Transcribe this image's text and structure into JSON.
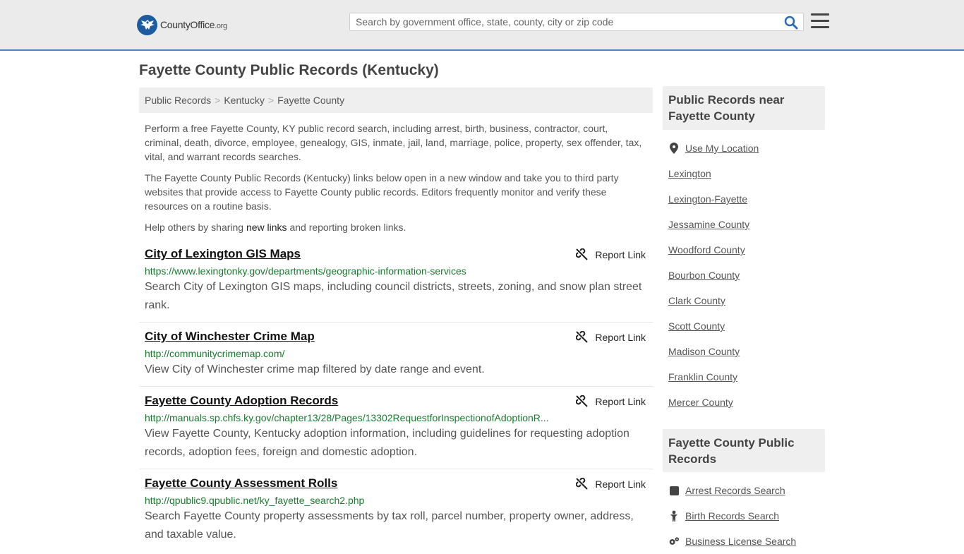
{
  "header": {
    "logo_brand": "CountyOffice",
    "logo_tld": ".org",
    "search_placeholder": "Search by government office, state, county, city or zip code"
  },
  "page": {
    "title": "Fayette County Public Records (Kentucky)"
  },
  "breadcrumb": [
    "Public Records",
    "Kentucky",
    "Fayette County"
  ],
  "intro": {
    "p1": "Perform a free Fayette County, KY public record search, including arrest, birth, business, contractor, court, criminal, death, divorce, employee, genealogy, GIS, inmate, jail, land, marriage, police, property, sex offender, tax, vital, and warrant records searches.",
    "p2": "The Fayette County Public Records (Kentucky) links below open in a new window and take you to third party websites that provide access to Fayette County public records. Editors frequently monitor and verify these resources on a routine basis.",
    "p3_before": "Help others by sharing ",
    "p3_link": "new links",
    "p3_after": " and reporting broken links."
  },
  "report_label": "Report Link",
  "records": [
    {
      "title": "City of Lexington GIS Maps",
      "url": "https://www.lexingtonky.gov/departments/geographic-information-services",
      "desc": "Search City of Lexington GIS maps, including council districts, streets, zoning, and snow plan street rank."
    },
    {
      "title": "City of Winchester Crime Map",
      "url": "http://communitycrimemap.com/",
      "desc": "View City of Winchester crime map filtered by date range and event."
    },
    {
      "title": "Fayette County Adoption Records",
      "url": "http://manuals.sp.chfs.ky.gov/chapter13/28/Pages/13302RequestforInspectionofAdoptionR...",
      "desc": "View Fayette County, Kentucky adoption information, including guidelines for requesting adoption records, adoption fees, foreign and domestic adoption."
    },
    {
      "title": "Fayette County Assessment Rolls",
      "url": "http://qpublic9.qpublic.net/ky_fayette_search2.php",
      "desc": "Search Fayette County property assessments by tax roll, parcel number, property owner, address, and taxable value."
    }
  ],
  "sidebar": {
    "near_title": "Public Records near Fayette County",
    "use_location": "Use My Location",
    "near_items": [
      "Lexington",
      "Lexington-Fayette",
      "Jessamine County",
      "Woodford County",
      "Bourbon County",
      "Clark County",
      "Scott County",
      "Madison County",
      "Franklin County",
      "Mercer County"
    ],
    "records_title": "Fayette County Public Records",
    "records_items": [
      {
        "label": "Arrest Records Search",
        "icon": "square-icon"
      },
      {
        "label": "Birth Records Search",
        "icon": "baby-icon"
      },
      {
        "label": "Business License Search",
        "icon": "gears-icon"
      }
    ]
  }
}
